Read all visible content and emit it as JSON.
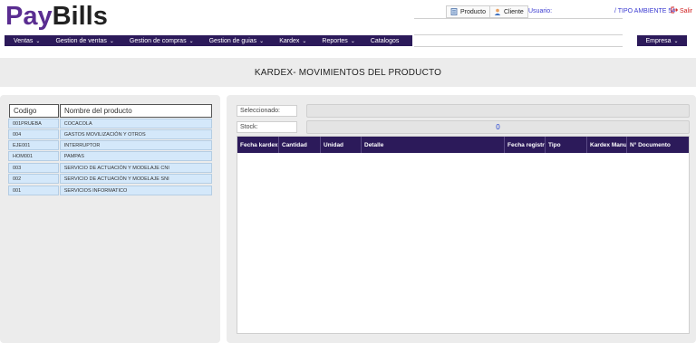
{
  "header": {
    "logo_part1": "Pay",
    "logo_part2": "Bills",
    "producto_label": "Producto",
    "cliente_label": "Cliente",
    "usuario_label": "Usuario:",
    "ambiente_label": "/ TIPO AMBIENTE 54",
    "salir_label": "Salir"
  },
  "nav": {
    "items": [
      {
        "label": "Ventas",
        "has_dropdown": true
      },
      {
        "label": "Gestion de ventas",
        "has_dropdown": true
      },
      {
        "label": "Gestion de compras",
        "has_dropdown": true
      },
      {
        "label": "Gestion de guias",
        "has_dropdown": true
      },
      {
        "label": "Kardex",
        "has_dropdown": true
      },
      {
        "label": "Reportes",
        "has_dropdown": true
      },
      {
        "label": "Catalogos",
        "has_dropdown": false
      }
    ],
    "empresa_label": "Empresa"
  },
  "page": {
    "title": "KARDEX- MOVIMIENTOS DEL PRODUCTO"
  },
  "products": {
    "col_codigo": "Codigo",
    "col_nombre": "Nombre del producto",
    "rows": [
      {
        "codigo": "001PRUEBA",
        "nombre": "COCACOLA"
      },
      {
        "codigo": "004",
        "nombre": "GASTOS MOVILIZACIÓN Y OTROS"
      },
      {
        "codigo": "EJE001",
        "nombre": "INTERRUPTOR"
      },
      {
        "codigo": "HOM001",
        "nombre": "PAMPAS"
      },
      {
        "codigo": "003",
        "nombre": "SERVICIO DE ACTUACIÓN Y MODELAJE CNI"
      },
      {
        "codigo": "002",
        "nombre": "SERVICIO DE ACTUACIÓN Y MODELAJE SNI"
      },
      {
        "codigo": "001",
        "nombre": "SERVICIOS INFORMATICO"
      }
    ]
  },
  "detail": {
    "seleccionado_label": "Seleccionado:",
    "seleccionado_value": "",
    "stock_label": "Stock:",
    "stock_value": "0",
    "columns": [
      "Fecha kardex",
      "Cantidad",
      "Unidad",
      "Detalle",
      "Fecha registro",
      "Tipo",
      "Kardex Manual",
      "N° Documento"
    ]
  },
  "colors": {
    "brand_purple": "#5a2d91",
    "nav_bg": "#2c1a5a",
    "row_bg": "#d4e8fa",
    "stock_value_color": "#1f3fd0",
    "salir_color": "#d02020"
  }
}
